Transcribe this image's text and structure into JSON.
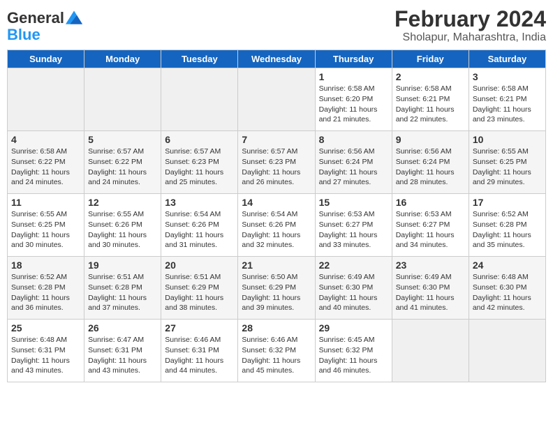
{
  "header": {
    "logo_line1": "General",
    "logo_line2": "Blue",
    "month_year": "February 2024",
    "location": "Sholapur, Maharashtra, India"
  },
  "days_of_week": [
    "Sunday",
    "Monday",
    "Tuesday",
    "Wednesday",
    "Thursday",
    "Friday",
    "Saturday"
  ],
  "weeks": [
    [
      {
        "day": "",
        "info": ""
      },
      {
        "day": "",
        "info": ""
      },
      {
        "day": "",
        "info": ""
      },
      {
        "day": "",
        "info": ""
      },
      {
        "day": "1",
        "sunrise": "6:58 AM",
        "sunset": "6:20 PM",
        "daylight": "11 hours and 21 minutes."
      },
      {
        "day": "2",
        "sunrise": "6:58 AM",
        "sunset": "6:21 PM",
        "daylight": "11 hours and 22 minutes."
      },
      {
        "day": "3",
        "sunrise": "6:58 AM",
        "sunset": "6:21 PM",
        "daylight": "11 hours and 23 minutes."
      }
    ],
    [
      {
        "day": "4",
        "sunrise": "6:58 AM",
        "sunset": "6:22 PM",
        "daylight": "11 hours and 24 minutes."
      },
      {
        "day": "5",
        "sunrise": "6:57 AM",
        "sunset": "6:22 PM",
        "daylight": "11 hours and 24 minutes."
      },
      {
        "day": "6",
        "sunrise": "6:57 AM",
        "sunset": "6:23 PM",
        "daylight": "11 hours and 25 minutes."
      },
      {
        "day": "7",
        "sunrise": "6:57 AM",
        "sunset": "6:23 PM",
        "daylight": "11 hours and 26 minutes."
      },
      {
        "day": "8",
        "sunrise": "6:56 AM",
        "sunset": "6:24 PM",
        "daylight": "11 hours and 27 minutes."
      },
      {
        "day": "9",
        "sunrise": "6:56 AM",
        "sunset": "6:24 PM",
        "daylight": "11 hours and 28 minutes."
      },
      {
        "day": "10",
        "sunrise": "6:55 AM",
        "sunset": "6:25 PM",
        "daylight": "11 hours and 29 minutes."
      }
    ],
    [
      {
        "day": "11",
        "sunrise": "6:55 AM",
        "sunset": "6:25 PM",
        "daylight": "11 hours and 30 minutes."
      },
      {
        "day": "12",
        "sunrise": "6:55 AM",
        "sunset": "6:26 PM",
        "daylight": "11 hours and 30 minutes."
      },
      {
        "day": "13",
        "sunrise": "6:54 AM",
        "sunset": "6:26 PM",
        "daylight": "11 hours and 31 minutes."
      },
      {
        "day": "14",
        "sunrise": "6:54 AM",
        "sunset": "6:26 PM",
        "daylight": "11 hours and 32 minutes."
      },
      {
        "day": "15",
        "sunrise": "6:53 AM",
        "sunset": "6:27 PM",
        "daylight": "11 hours and 33 minutes."
      },
      {
        "day": "16",
        "sunrise": "6:53 AM",
        "sunset": "6:27 PM",
        "daylight": "11 hours and 34 minutes."
      },
      {
        "day": "17",
        "sunrise": "6:52 AM",
        "sunset": "6:28 PM",
        "daylight": "11 hours and 35 minutes."
      }
    ],
    [
      {
        "day": "18",
        "sunrise": "6:52 AM",
        "sunset": "6:28 PM",
        "daylight": "11 hours and 36 minutes."
      },
      {
        "day": "19",
        "sunrise": "6:51 AM",
        "sunset": "6:28 PM",
        "daylight": "11 hours and 37 minutes."
      },
      {
        "day": "20",
        "sunrise": "6:51 AM",
        "sunset": "6:29 PM",
        "daylight": "11 hours and 38 minutes."
      },
      {
        "day": "21",
        "sunrise": "6:50 AM",
        "sunset": "6:29 PM",
        "daylight": "11 hours and 39 minutes."
      },
      {
        "day": "22",
        "sunrise": "6:49 AM",
        "sunset": "6:30 PM",
        "daylight": "11 hours and 40 minutes."
      },
      {
        "day": "23",
        "sunrise": "6:49 AM",
        "sunset": "6:30 PM",
        "daylight": "11 hours and 41 minutes."
      },
      {
        "day": "24",
        "sunrise": "6:48 AM",
        "sunset": "6:30 PM",
        "daylight": "11 hours and 42 minutes."
      }
    ],
    [
      {
        "day": "25",
        "sunrise": "6:48 AM",
        "sunset": "6:31 PM",
        "daylight": "11 hours and 43 minutes."
      },
      {
        "day": "26",
        "sunrise": "6:47 AM",
        "sunset": "6:31 PM",
        "daylight": "11 hours and 43 minutes."
      },
      {
        "day": "27",
        "sunrise": "6:46 AM",
        "sunset": "6:31 PM",
        "daylight": "11 hours and 44 minutes."
      },
      {
        "day": "28",
        "sunrise": "6:46 AM",
        "sunset": "6:32 PM",
        "daylight": "11 hours and 45 minutes."
      },
      {
        "day": "29",
        "sunrise": "6:45 AM",
        "sunset": "6:32 PM",
        "daylight": "11 hours and 46 minutes."
      },
      {
        "day": "",
        "info": ""
      },
      {
        "day": "",
        "info": ""
      }
    ]
  ]
}
